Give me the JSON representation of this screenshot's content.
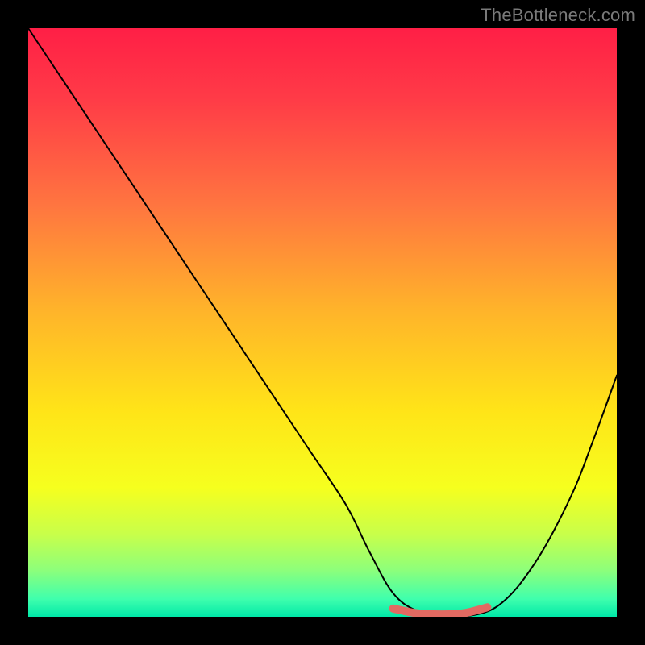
{
  "watermark": "TheBottleneck.com",
  "chart_data": {
    "type": "line",
    "title": "",
    "xlabel": "",
    "ylabel": "",
    "xlim": [
      0,
      100
    ],
    "ylim": [
      0,
      100
    ],
    "grid": false,
    "legend": false,
    "series": [
      {
        "name": "bottleneck-curve",
        "color": "#000000",
        "x": [
          0,
          6,
          12,
          18,
          24,
          30,
          36,
          42,
          48,
          54,
          58,
          62,
          66,
          70,
          74,
          80,
          86,
          92,
          96,
          100
        ],
        "y": [
          100,
          91,
          82,
          73,
          64,
          55,
          46,
          37,
          28,
          19,
          11,
          4,
          1,
          0,
          0,
          2,
          9,
          20,
          30,
          41
        ]
      },
      {
        "name": "optimal-range-marker",
        "color": "#e26a62",
        "x": [
          62,
          66,
          70,
          74,
          78
        ],
        "y": [
          1.4,
          0.6,
          0.4,
          0.6,
          1.6
        ]
      }
    ],
    "background_gradient": {
      "stops": [
        {
          "offset": 0.0,
          "color": "#ff1f46"
        },
        {
          "offset": 0.12,
          "color": "#ff3b47"
        },
        {
          "offset": 0.3,
          "color": "#ff7540"
        },
        {
          "offset": 0.48,
          "color": "#ffb42a"
        },
        {
          "offset": 0.65,
          "color": "#ffe418"
        },
        {
          "offset": 0.78,
          "color": "#f6ff1e"
        },
        {
          "offset": 0.86,
          "color": "#c8ff4a"
        },
        {
          "offset": 0.92,
          "color": "#8eff7a"
        },
        {
          "offset": 0.97,
          "color": "#3fffad"
        },
        {
          "offset": 1.0,
          "color": "#00e8a8"
        }
      ]
    }
  }
}
